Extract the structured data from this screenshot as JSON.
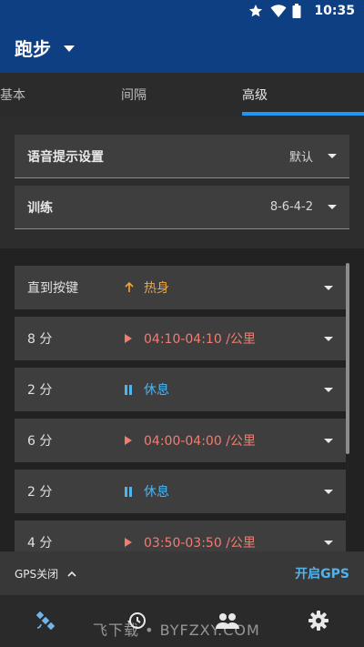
{
  "status_bar": {
    "time": "10:35"
  },
  "app_bar": {
    "title": "跑步"
  },
  "tabs": [
    {
      "label": "基本"
    },
    {
      "label": "间隔"
    },
    {
      "label": "高级"
    }
  ],
  "settings": [
    {
      "label": "语音提示设置",
      "value": "默认"
    },
    {
      "label": "训练",
      "value": "8-6-4-2"
    }
  ],
  "workout_steps": [
    {
      "duration": "直到按键",
      "icon": "arrow-up-icon",
      "text": "热身",
      "color": "#f0a63a"
    },
    {
      "duration": "8 分",
      "icon": "play-icon",
      "text": "04:10-04:10 /公里",
      "color": "#f27c70"
    },
    {
      "duration": "2 分",
      "icon": "pause-icon",
      "text": "休息",
      "color": "#4fb3f0"
    },
    {
      "duration": "6 分",
      "icon": "play-icon",
      "text": "04:00-04:00 /公里",
      "color": "#f27c70"
    },
    {
      "duration": "2 分",
      "icon": "pause-icon",
      "text": "休息",
      "color": "#4fb3f0"
    },
    {
      "duration": "4 分",
      "icon": "play-icon",
      "text": "03:50-03:50 /公里",
      "color": "#f27c70"
    }
  ],
  "gps": {
    "label": "GPS关闭",
    "action": "开启GPS"
  },
  "bottom_nav": [
    {
      "icon": "satellite-icon"
    },
    {
      "icon": "history-icon"
    },
    {
      "icon": "people-icon"
    },
    {
      "icon": "gear-icon"
    }
  ],
  "watermark": "飞下载 • BYFZXY.COM",
  "colors": {
    "primary": "#0d3f82",
    "accent": "#2196f3",
    "warmup": "#f0a63a",
    "run": "#f27c70",
    "rest": "#4fb3f0"
  }
}
